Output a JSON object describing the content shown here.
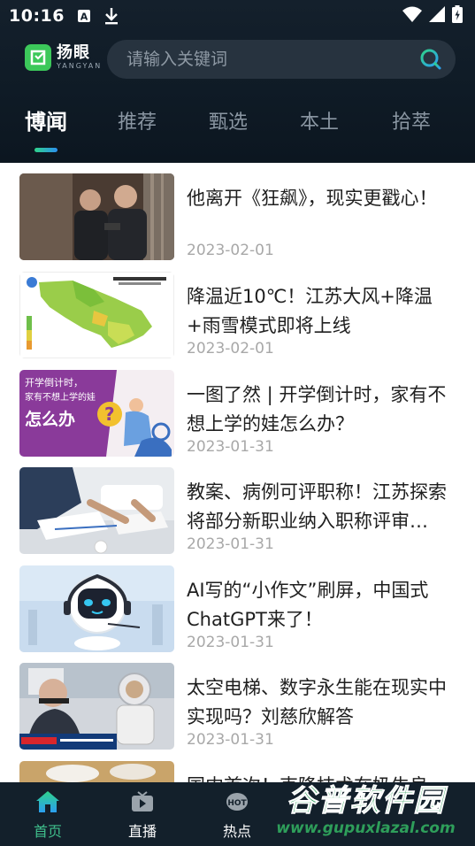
{
  "status_bar": {
    "time": "10:16",
    "left_icons": [
      "text-a-icon",
      "download-icon"
    ],
    "right_icons": [
      "wifi-icon",
      "signal-icon",
      "battery-icon"
    ]
  },
  "app": {
    "logo_cn": "扬眼",
    "logo_en": "YANGYAN",
    "accent": "#3cc85a"
  },
  "search": {
    "placeholder": "请输入关键词",
    "value": ""
  },
  "tabs": [
    {
      "label": "博闻",
      "active": true
    },
    {
      "label": "推荐",
      "active": false
    },
    {
      "label": "甄选",
      "active": false
    },
    {
      "label": "本土",
      "active": false
    },
    {
      "label": "拾萃",
      "active": false
    }
  ],
  "articles": [
    {
      "title": "他离开《狂飙》，现实更戳心！",
      "date": "2023-02-01"
    },
    {
      "title": "降温近10℃！江苏大风+降温+雨雪模式即将上线",
      "date": "2023-02-01"
    },
    {
      "title": "一图了然 | 开学倒计时，家有不想上学的娃怎么办？",
      "date": "2023-01-31",
      "thumb_text": [
        "开学倒计时，",
        "家有不想上学的娃",
        "怎么办"
      ]
    },
    {
      "title": "教案、病例可评职称！江苏探索将部分新职业纳入职称评审…",
      "date": "2023-01-31"
    },
    {
      "title": "AI写的“小作文”刷屏，中国式ChatGPT来了！",
      "date": "2023-01-31"
    },
    {
      "title": "太空电梯、数字永生能在现实中实现吗？刘慈欣解答",
      "date": "2023-01-31"
    },
    {
      "title": "国内首次！克隆技术在奶牛良",
      "date": ""
    }
  ],
  "bottom_nav": [
    {
      "label": "首页",
      "icon": "home-icon",
      "active": true
    },
    {
      "label": "直播",
      "icon": "tv-icon",
      "active": false
    },
    {
      "label": "热点",
      "icon": "hot-icon",
      "active": false
    }
  ],
  "watermark": {
    "text": "谷普软件园",
    "url": "www.gupuxlazal.com"
  }
}
